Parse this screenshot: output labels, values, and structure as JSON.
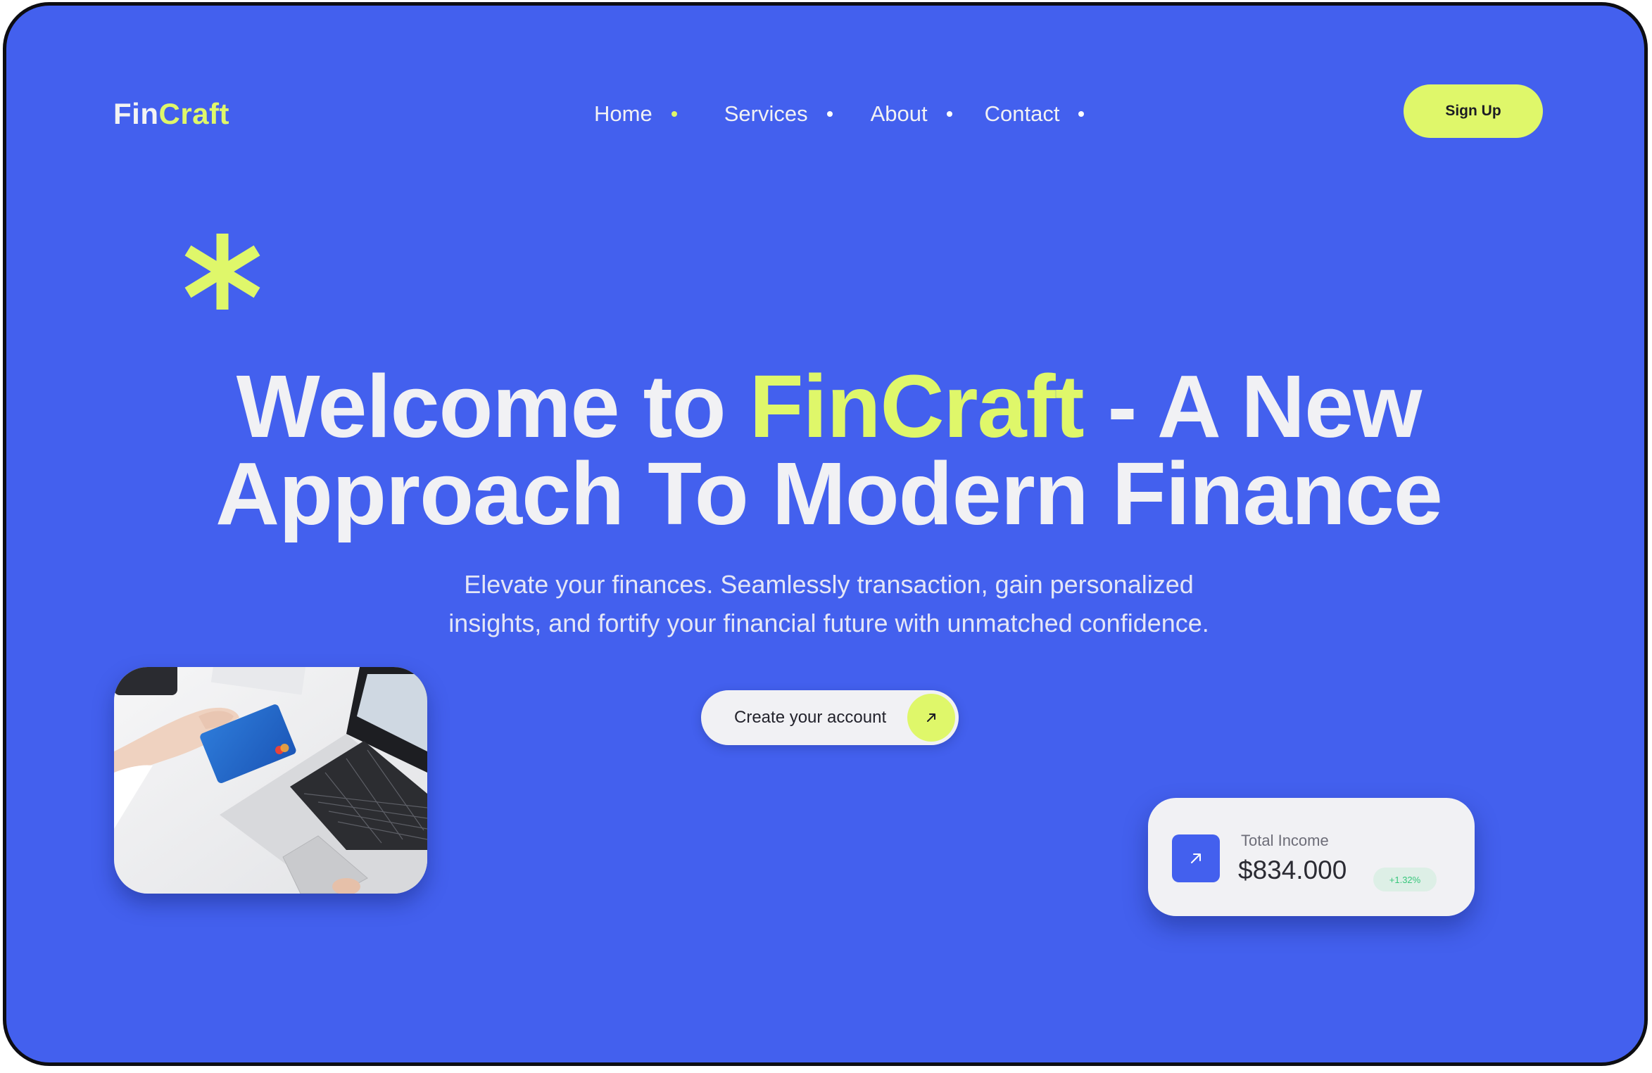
{
  "brand": {
    "name_part1": "Fin",
    "name_part2": "Craft",
    "accent_color": "#dff76a",
    "background_color": "#4360ee"
  },
  "nav": {
    "items": [
      {
        "label": "Home"
      },
      {
        "label": "Services"
      },
      {
        "label": "About"
      },
      {
        "label": "Contact"
      }
    ]
  },
  "header": {
    "signup_label": "Sign Up"
  },
  "hero": {
    "decoration_icon": "asterisk-icon",
    "title_part1": "Welcome to ",
    "title_accent": "FinCraft",
    "title_part2": " - A New",
    "title_line2": "Approach To Modern Finance",
    "subtitle_line1": "Elevate your finances. Seamlessly transaction, gain personalized",
    "subtitle_line2": "insights, and fortify your financial future with unmatched confidence.",
    "cta_label": "Create your account",
    "cta_icon": "arrow-up-right-icon"
  },
  "income_card": {
    "icon": "arrow-up-right-icon",
    "label": "Total Income",
    "value": "$834.000",
    "change": "+1.32%"
  }
}
